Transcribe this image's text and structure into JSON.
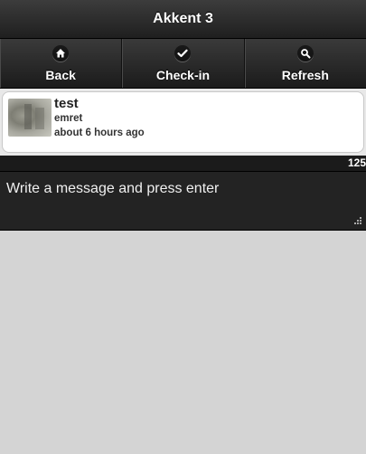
{
  "header": {
    "title": "Akkent 3"
  },
  "nav": [
    {
      "label": "Back",
      "icon": "home-icon"
    },
    {
      "label": "Check-in",
      "icon": "check-icon"
    },
    {
      "label": "Refresh",
      "icon": "search-icon"
    }
  ],
  "posts": [
    {
      "title": "test",
      "user": "emret",
      "time": "about 6 hours ago",
      "thumb": "photo-thumbnail"
    }
  ],
  "composer": {
    "remaining": "125",
    "placeholder": "Write a message and press enter"
  },
  "colors": {
    "bar": "#222222",
    "page_bg": "#d4d4d4",
    "card_bg": "#ffffff"
  }
}
